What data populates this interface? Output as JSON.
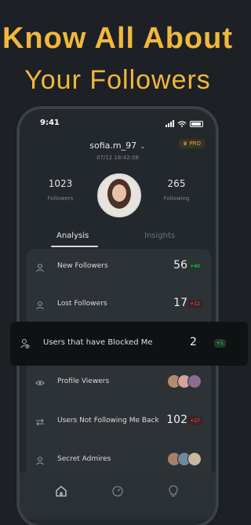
{
  "hero": {
    "line1": "Know All About",
    "line2": "Your Followers"
  },
  "status_bar": {
    "time": "9:41"
  },
  "profile": {
    "username": "sofia.m_97",
    "pro_label": "PRO",
    "date": "07/12 18:42:08",
    "followers": {
      "count": "1023",
      "label": "Followers"
    },
    "following": {
      "count": "265",
      "label": "Following"
    }
  },
  "tabs": {
    "analysis": "Analysis",
    "insights": "Insights"
  },
  "rows": {
    "new_followers": {
      "label": "New Followers",
      "count": "56",
      "delta": "+40"
    },
    "lost_followers": {
      "label": "Lost Followers",
      "count": "17",
      "delta": "+12"
    },
    "blocked": {
      "label": "Users that have Blocked Me",
      "count": "2",
      "delta": "+1"
    },
    "profile_viewers": {
      "label": "Profile Viewers"
    },
    "not_following_back": {
      "label": "Users Not Following Me Back",
      "count": "102",
      "delta": "+27"
    },
    "secret_admirers": {
      "label": "Secret Admires"
    }
  },
  "colors": {
    "accent": "#f1b83b",
    "positive": "#4fd07b",
    "negative": "#e05a5e"
  }
}
